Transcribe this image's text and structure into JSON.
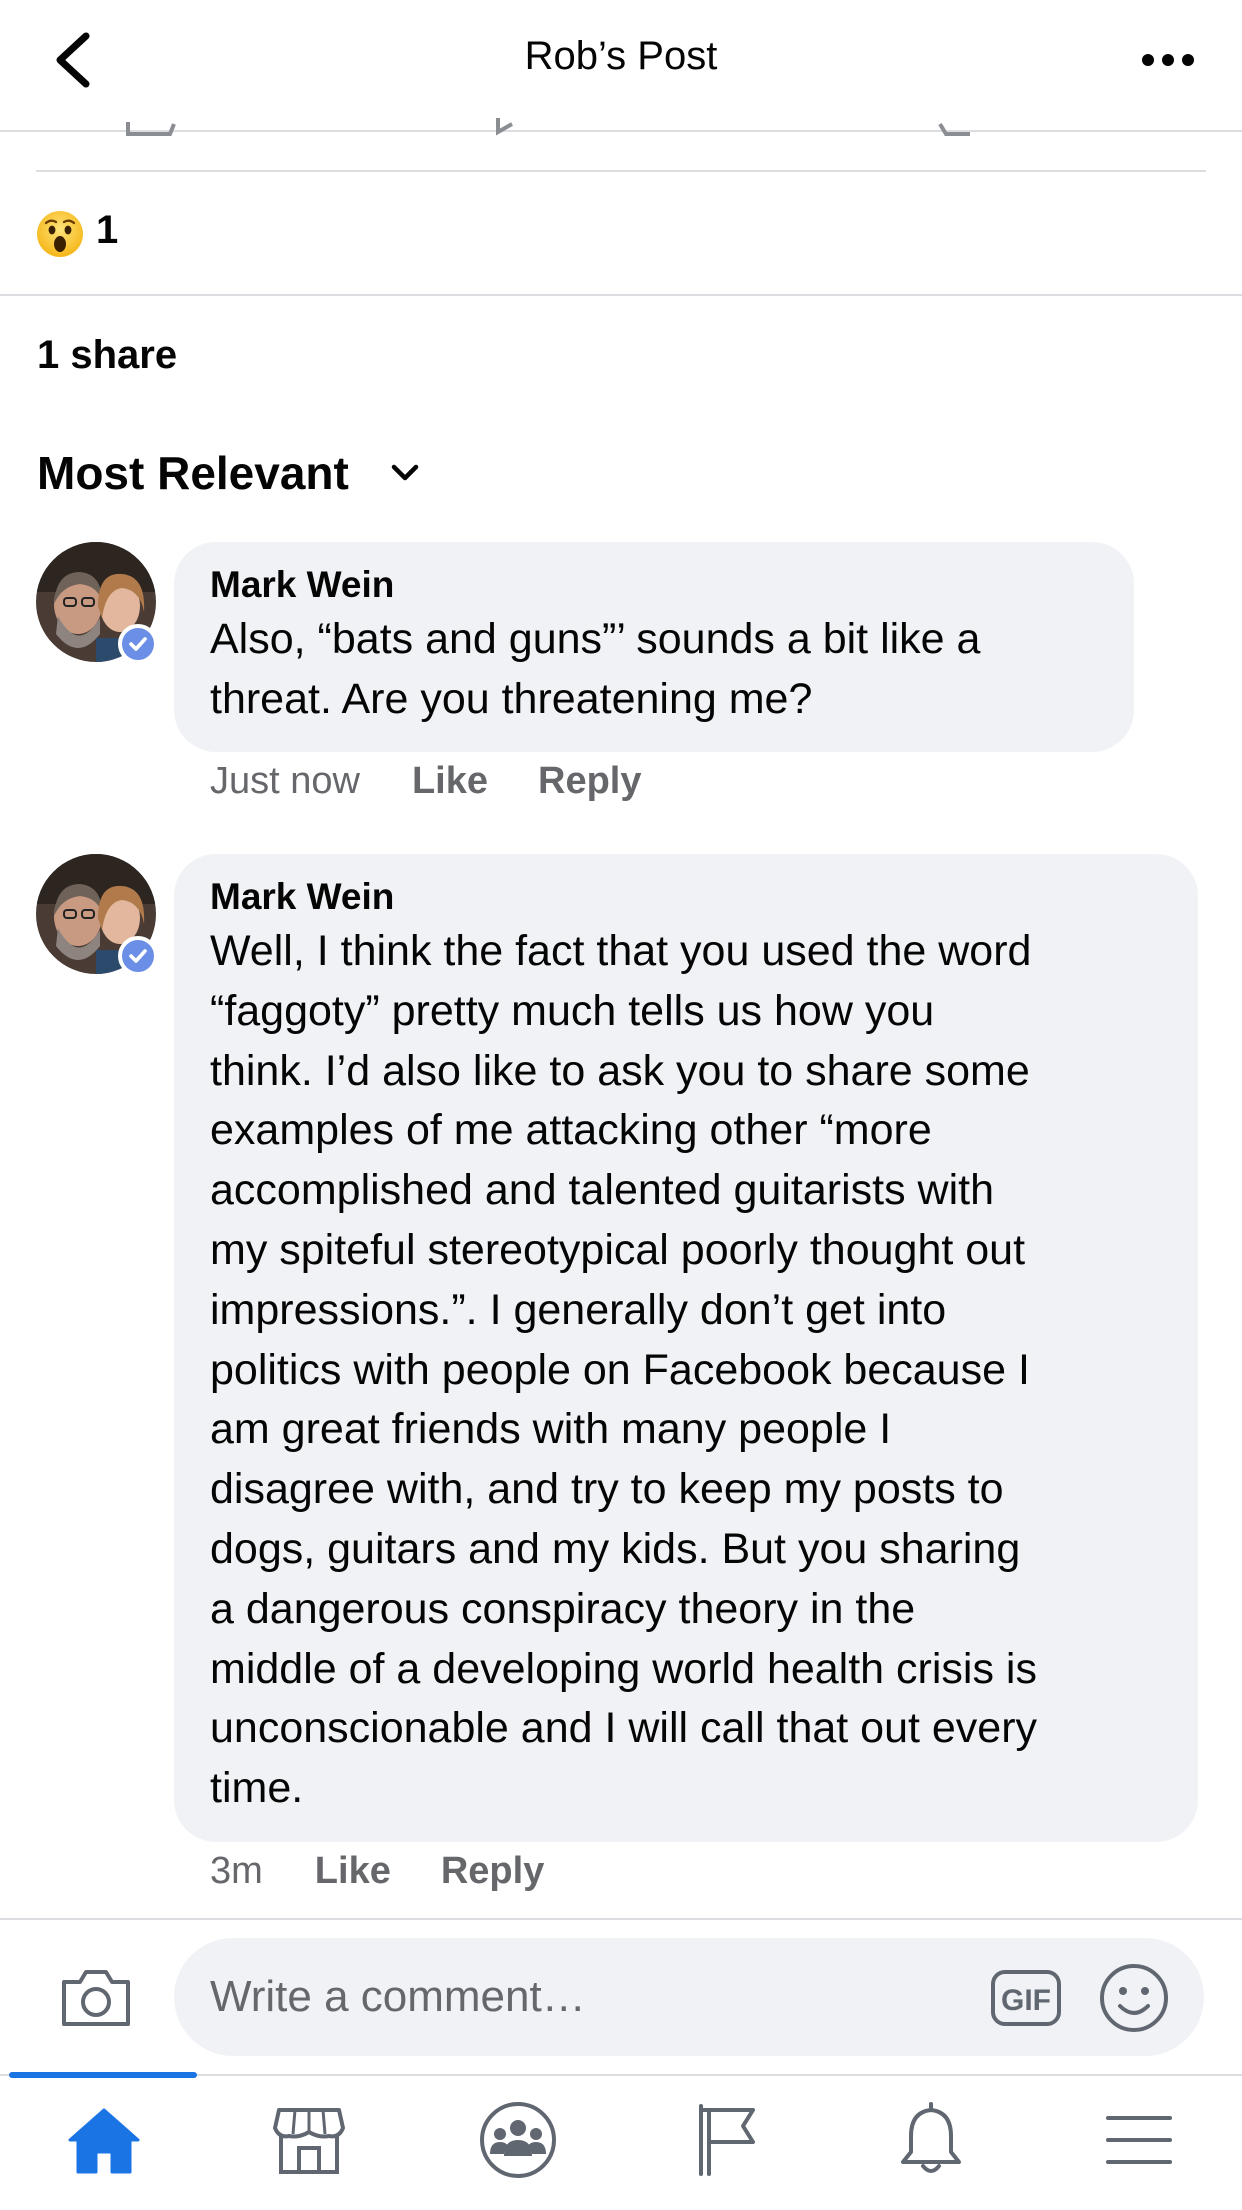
{
  "header": {
    "title": "Rob’s Post"
  },
  "reactions": {
    "emoji": "wow-emoji",
    "count": "1"
  },
  "shares": {
    "label": "1 share"
  },
  "sort": {
    "label": "Most Relevant"
  },
  "comments": [
    {
      "author": "Mark Wein",
      "text": "Also, “bats and guns”’ sounds a bit like a\nthreat.  Are you threatening me?",
      "time": "Just now",
      "like_label": "Like",
      "reply_label": "Reply"
    },
    {
      "author": "Mark Wein",
      "text": "Well, I think the fact that you used the word\n“faggoty” pretty much tells us how you\nthink.  I’d also like to ask you to share some\nexamples of me attacking other “more\naccomplished and talented guitarists with\nmy spiteful stereotypical poorly thought out\nimpressions.”.  I generally don’t get into\npolitics with people on Facebook because I\nam great friends with many people I\ndisagree with, and try to keep my posts to\ndogs, guitars and my kids.  But you sharing\na dangerous conspiracy theory in the\nmiddle of a developing world health crisis is\nunconscionable and I will call that out every\ntime.",
      "time": "3m",
      "like_label": "Like",
      "reply_label": "Reply"
    }
  ],
  "composer": {
    "placeholder": "Write a comment…",
    "gif_label": "GIF"
  },
  "tabs": [
    {
      "name": "home",
      "icon": "home-icon",
      "active": true
    },
    {
      "name": "marketplace",
      "icon": "marketplace-icon",
      "active": false
    },
    {
      "name": "groups",
      "icon": "groups-icon",
      "active": false
    },
    {
      "name": "pages",
      "icon": "flag-icon",
      "active": false
    },
    {
      "name": "notifications",
      "icon": "bell-icon",
      "active": false
    },
    {
      "name": "menu",
      "icon": "menu-icon",
      "active": false
    }
  ],
  "colors": {
    "accent": "#1b74e4",
    "bubble": "#f0f2f5",
    "muted": "#65676b",
    "verified": "#6b8fe6"
  }
}
